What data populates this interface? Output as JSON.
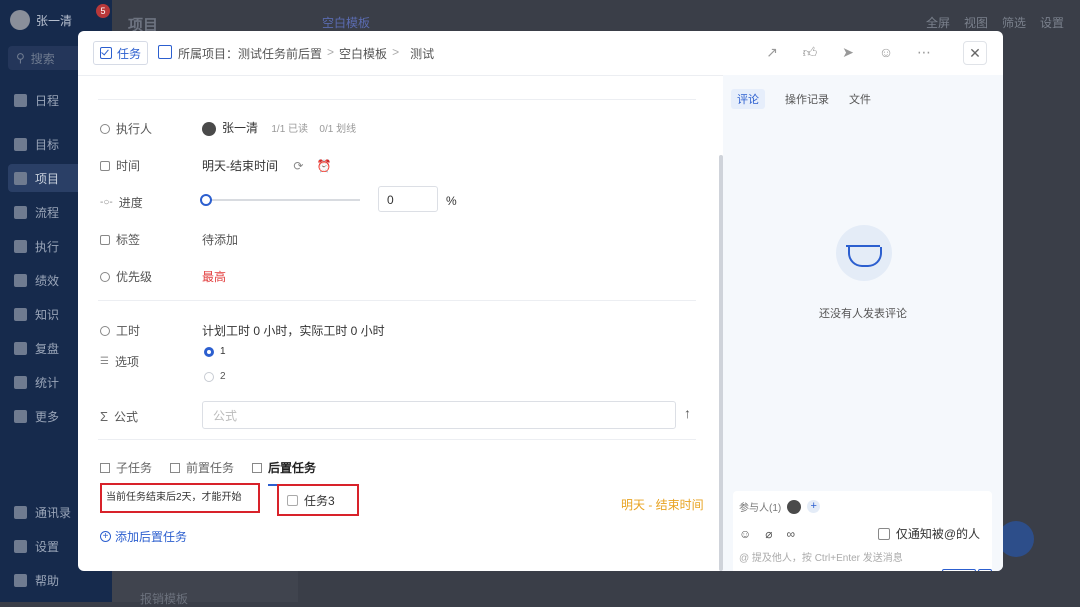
{
  "background": {
    "user_name": "张一清",
    "notification_count": "5",
    "search_placeholder": "搜索",
    "sidebar_items": [
      {
        "label": "日程",
        "icon": "calendar-icon"
      },
      {
        "label": "目标",
        "icon": "target-icon"
      },
      {
        "label": "项目",
        "icon": "project-icon"
      },
      {
        "label": "流程",
        "icon": "workflow-icon"
      },
      {
        "label": "执行",
        "icon": "execute-icon"
      },
      {
        "label": "绩效",
        "icon": "performance-icon"
      },
      {
        "label": "知识",
        "icon": "book-icon"
      },
      {
        "label": "复盘",
        "icon": "review-icon"
      },
      {
        "label": "统计",
        "icon": "stats-icon"
      },
      {
        "label": "更多",
        "icon": "grid-icon"
      },
      {
        "label": "通讯录",
        "icon": "contacts-icon"
      },
      {
        "label": "设置",
        "icon": "gear-icon"
      },
      {
        "label": "帮助",
        "icon": "help-icon"
      }
    ],
    "active_sidebar": "项目",
    "top_title": "项目",
    "template_name": "空白模板",
    "toolbar": {
      "fullscreen": "全屏",
      "view": "视图",
      "filter": "筛选",
      "settings": "设置"
    },
    "list_item": "报销模板"
  },
  "modal": {
    "type_tag": "任务",
    "breadcrumb": {
      "prefix": "所属项目：",
      "project": "测试任务前后置",
      "template": "空白模板",
      "task": "测试"
    },
    "close_label": "✕",
    "fields": {
      "assignee": {
        "label": "执行人",
        "name": "张一清",
        "read": "1/1 已读",
        "crossed": "0/1 划线"
      },
      "time": {
        "label": "时间",
        "value": "明天-结束时间"
      },
      "progress": {
        "label": "进度",
        "value": "0",
        "unit": "%",
        "percent": 0
      },
      "tags": {
        "label": "标签",
        "value": "待添加"
      },
      "priority": {
        "label": "优先级",
        "value": "最高",
        "color": "#e23b3b"
      },
      "work_hours": {
        "label": "工时",
        "value": "计划工时 0 小时，实际工时 0 小时"
      },
      "options": {
        "label": "选项",
        "items": [
          {
            "label": "1",
            "checked": true
          },
          {
            "label": "2",
            "checked": false
          }
        ]
      },
      "formula": {
        "label": "公式",
        "placeholder": "公式"
      }
    },
    "subtabs": [
      {
        "label": "子任务",
        "active": false
      },
      {
        "label": "前置任务",
        "active": false
      },
      {
        "label": "后置任务",
        "active": true
      }
    ],
    "successor": {
      "condition": "当前任务结束后2天，才能开始",
      "task_name": "任务3",
      "date_range": "明天 - 结束时间"
    },
    "add_successor": "添加后置任务",
    "comments": {
      "tabs": [
        {
          "label": "评论",
          "active": true
        },
        {
          "label": "操作记录",
          "active": false
        },
        {
          "label": "文件",
          "active": false
        }
      ],
      "empty_text": "还没有人发表评论",
      "participants_label": "参与人(1)",
      "notify_label": "仅通知被@的人",
      "input_placeholder": "@ 提及他人，按 Ctrl+Enter 发送消息",
      "send_label": "发送"
    }
  },
  "colors": {
    "accent": "#2c5fcf",
    "priority": "#e23b3b",
    "date": "#e8a321",
    "highlight_border": "#d8222a"
  }
}
